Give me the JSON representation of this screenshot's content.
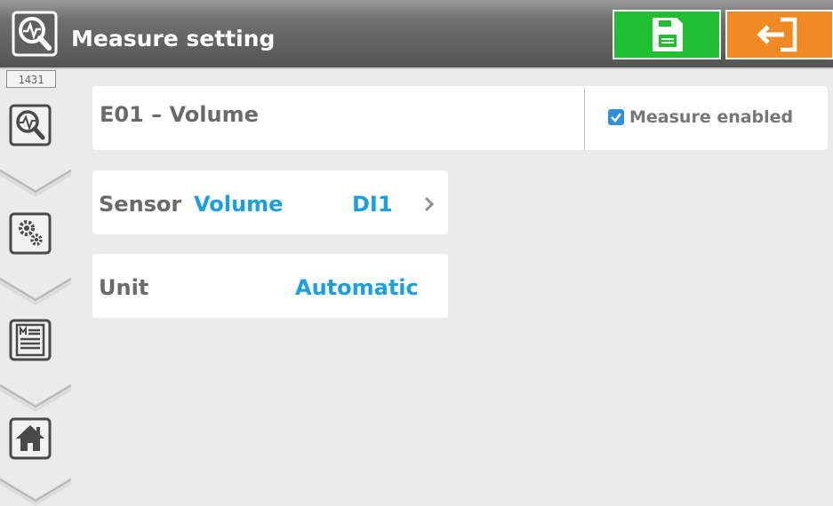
{
  "header": {
    "title": "Measure setting",
    "colors": {
      "save": "#1fbf32",
      "exit": "#f28a24"
    },
    "icons": {
      "app": "measure-search-icon",
      "save": "floppy-save-icon",
      "exit": "exit-door-icon"
    }
  },
  "sidebar": {
    "counter": "1431",
    "items": [
      {
        "icon": "measure-search-icon"
      },
      {
        "icon": "gears-icon"
      },
      {
        "icon": "manual-list-icon"
      },
      {
        "icon": "home-icon"
      }
    ]
  },
  "measure": {
    "title": "E01 – Volume",
    "enabled_label": "Measure enabled",
    "enabled": true
  },
  "sensor": {
    "label": "Sensor",
    "name": "Volume",
    "channel": "DI1"
  },
  "unit": {
    "label": "Unit",
    "value": "Automatic"
  },
  "accent": "#1aa0e0"
}
